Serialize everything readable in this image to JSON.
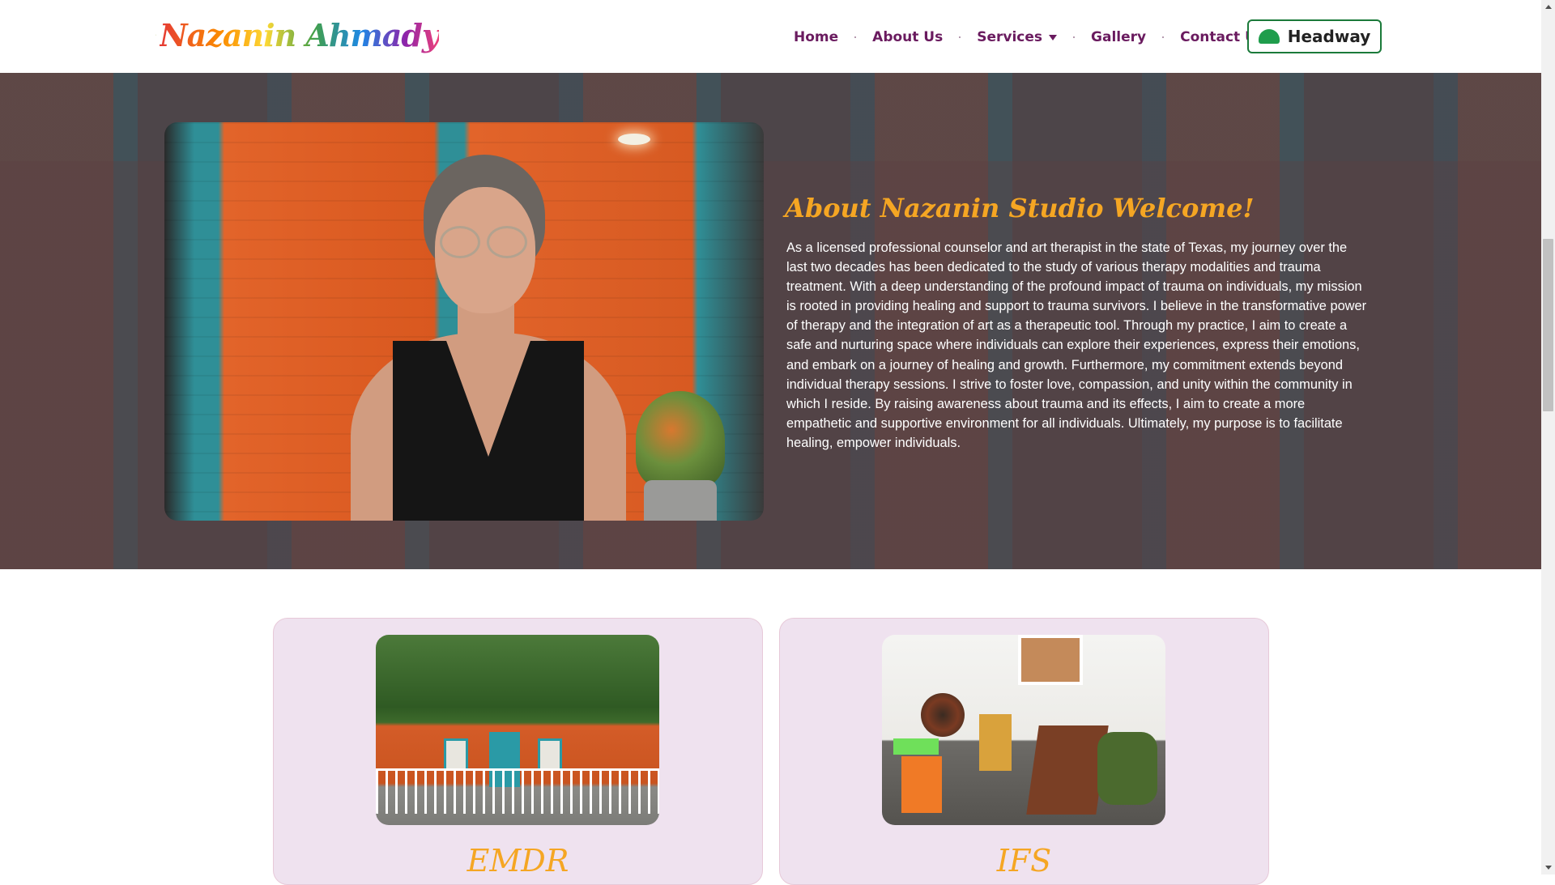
{
  "header": {
    "logo_text": "Nazanin Ahmady",
    "nav": [
      {
        "label": "Home"
      },
      {
        "label": "About Us"
      },
      {
        "label": "Services"
      },
      {
        "label": "Gallery"
      },
      {
        "label": "Contact Us"
      }
    ],
    "cta_label": "Headway"
  },
  "about": {
    "title": "About Nazanin Studio Welcome!",
    "text": "As a licensed professional counselor and art therapist in the state of Texas, my journey over the last two decades has been dedicated to the study of various therapy modalities and trauma treatment. With a deep understanding of the profound impact of trauma on individuals, my mission is rooted in providing healing and support to trauma survivors. I believe in the transformative power of therapy and the integration of art as a therapeutic tool. Through my practice, I aim to create a safe and nurturing space where individuals can explore their experiences, express their emotions, and embark on a journey of healing and growth. Furthermore, my commitment extends beyond individual therapy sessions. I strive to foster love, compassion, and unity within the community in which I reside. By raising awareness about trauma and its effects, I aim to create a more empathetic and supportive environment for all individuals. Ultimately, my purpose is to facilitate healing, empower individuals."
  },
  "cards": [
    {
      "title": "EMDR"
    },
    {
      "title": "IFS"
    }
  ],
  "colors": {
    "nav_text": "#6a1b5f",
    "accent_gold": "#f5a623",
    "headway_green": "#1f9d4c",
    "card_bg": "#efe2ef"
  },
  "icons": {
    "logo": "rainbow-seahorse-logo",
    "headway": "headway-cloud-icon",
    "services_caret": "caret-down-icon"
  }
}
